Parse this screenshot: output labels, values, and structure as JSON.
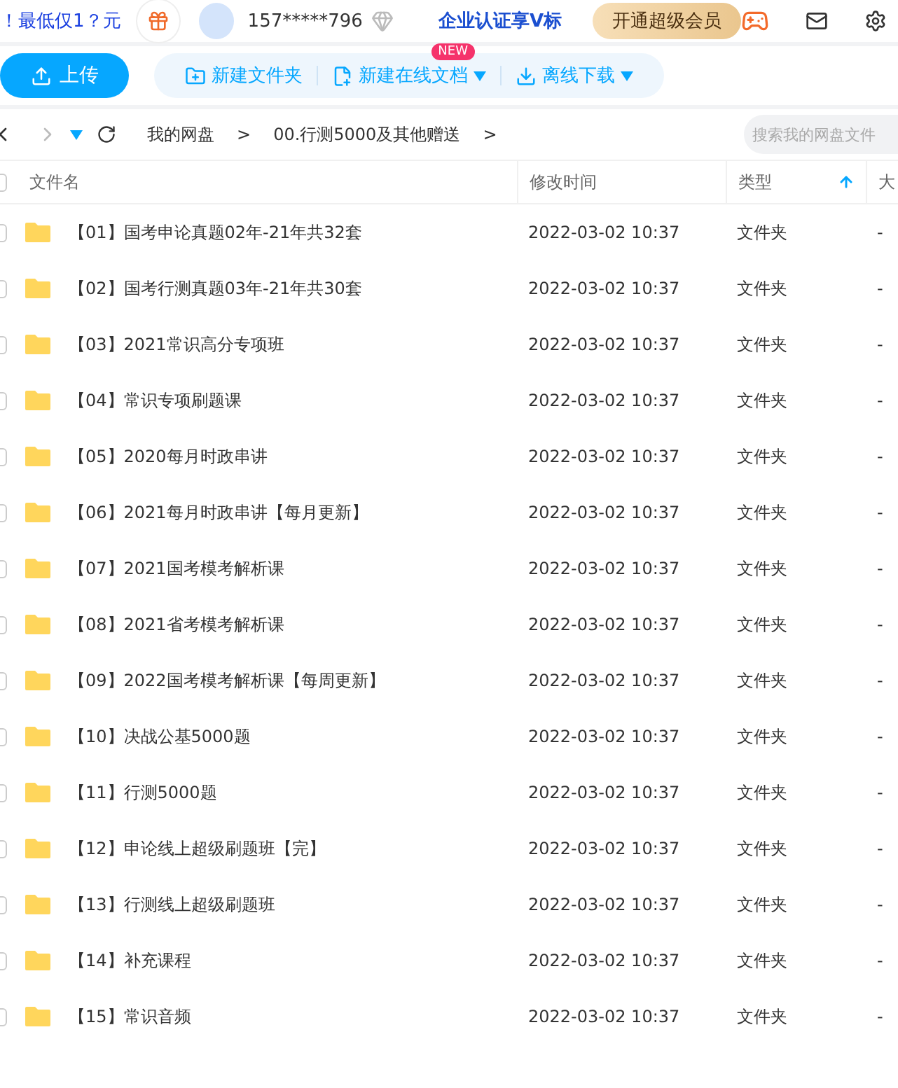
{
  "top_bar": {
    "promo": "！最低仅1？元",
    "user": "157*****796",
    "enterprise": "企业认证享V标",
    "vip_button": "开通超级会员"
  },
  "toolbar": {
    "upload": "上传",
    "actions": [
      {
        "label": "新建文件夹",
        "kind": "folder",
        "dropdown": false
      },
      {
        "label": "新建在线文档",
        "kind": "doc",
        "dropdown": true,
        "badge": "NEW"
      },
      {
        "label": "离线下载",
        "kind": "download",
        "dropdown": true
      }
    ]
  },
  "breadcrumb": [
    {
      "label": "我的网盘",
      "kind": "item"
    },
    {
      "label": ">",
      "kind": "separator"
    },
    {
      "label": "00.行测5000及其他赠送",
      "kind": "item"
    },
    {
      "label": ">",
      "kind": "separator"
    }
  ],
  "search": {
    "placeholder": "搜索我的网盘文件"
  },
  "table": {
    "select_all_checked": false,
    "columns": [
      {
        "label": "文件名",
        "sorted": false
      },
      {
        "label": "修改时间",
        "sorted": false
      },
      {
        "label": "类型",
        "sorted": true
      },
      {
        "label": "大"
      }
    ],
    "rows": [
      {
        "name": "【01】国考申论真题02年-21年共32套",
        "modified": "2022-03-02 10:37",
        "type": "文件夹",
        "size": "-",
        "checked": false
      },
      {
        "name": "【02】国考行测真题03年-21年共30套",
        "modified": "2022-03-02 10:37",
        "type": "文件夹",
        "size": "-",
        "checked": false
      },
      {
        "name": "【03】2021常识高分专项班",
        "modified": "2022-03-02 10:37",
        "type": "文件夹",
        "size": "-",
        "checked": false
      },
      {
        "name": "【04】常识专项刷题课",
        "modified": "2022-03-02 10:37",
        "type": "文件夹",
        "size": "-",
        "checked": false
      },
      {
        "name": "【05】2020每月时政串讲",
        "modified": "2022-03-02 10:37",
        "type": "文件夹",
        "size": "-",
        "checked": false
      },
      {
        "name": "【06】2021每月时政串讲【每月更新】",
        "modified": "2022-03-02 10:37",
        "type": "文件夹",
        "size": "-",
        "checked": false
      },
      {
        "name": "【07】2021国考模考解析课",
        "modified": "2022-03-02 10:37",
        "type": "文件夹",
        "size": "-",
        "checked": false
      },
      {
        "name": "【08】2021省考模考解析课",
        "modified": "2022-03-02 10:37",
        "type": "文件夹",
        "size": "-",
        "checked": false
      },
      {
        "name": "【09】2022国考模考解析课【每周更新】",
        "modified": "2022-03-02 10:37",
        "type": "文件夹",
        "size": "-",
        "checked": false
      },
      {
        "name": "【10】决战公基5000题",
        "modified": "2022-03-02 10:37",
        "type": "文件夹",
        "size": "-",
        "checked": false
      },
      {
        "name": "【11】行测5000题",
        "modified": "2022-03-02 10:37",
        "type": "文件夹",
        "size": "-",
        "checked": false
      },
      {
        "name": "【12】申论线上超级刷题班【完】",
        "modified": "2022-03-02 10:37",
        "type": "文件夹",
        "size": "-",
        "checked": false
      },
      {
        "name": "【13】行测线上超级刷题班",
        "modified": "2022-03-02 10:37",
        "type": "文件夹",
        "size": "-",
        "checked": false
      },
      {
        "name": "【14】补充课程",
        "modified": "2022-03-02 10:37",
        "type": "文件夹",
        "size": "-",
        "checked": false
      },
      {
        "name": "【15】常识音频",
        "modified": "2022-03-02 10:37",
        "type": "文件夹",
        "size": "-",
        "checked": false
      }
    ]
  }
}
